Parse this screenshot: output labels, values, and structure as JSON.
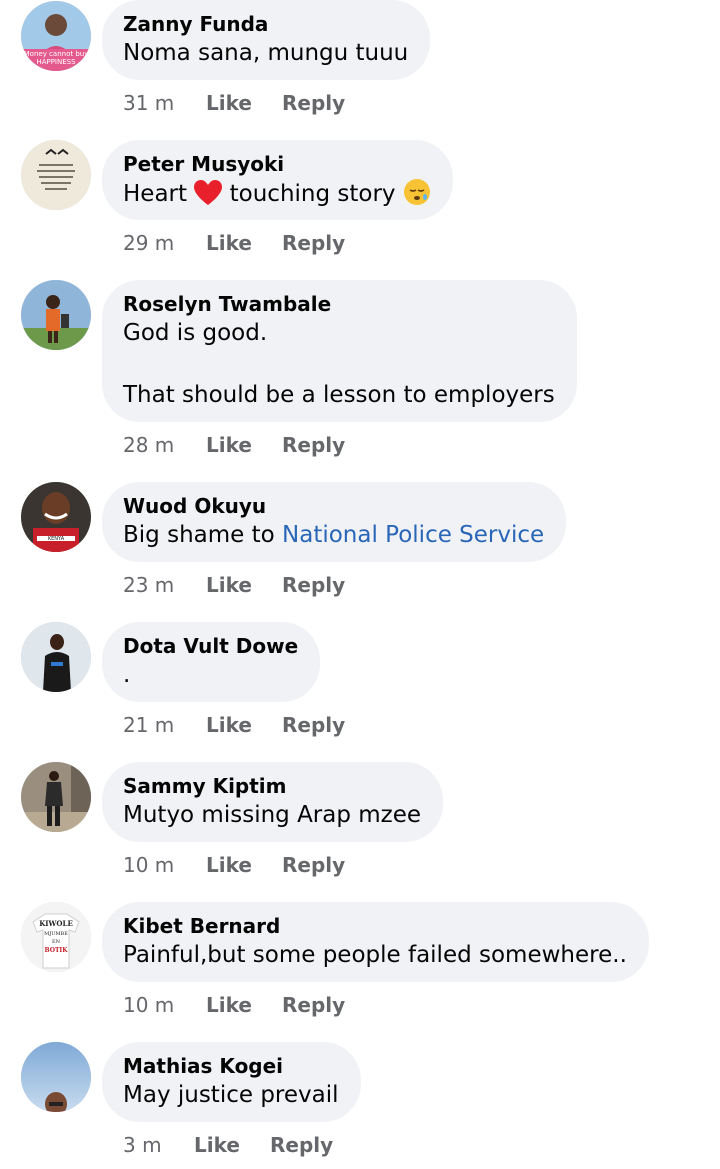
{
  "comments": [
    {
      "name": "Zanny Funda",
      "text": "Noma sana, mungu tuuu",
      "time": "31 m",
      "like": "Like",
      "reply": "Reply",
      "avatar_text": "Money cannot buy HAPPINESS"
    },
    {
      "name": "Peter Musyoki",
      "text_before": "Heart",
      "text_after": "touching story",
      "time": "29 m",
      "like": "Like",
      "reply": "Reply"
    },
    {
      "name": "Roselyn Twambale",
      "line1": "God is good.",
      "line2": "That should be a lesson to employers",
      "time": "28 m",
      "like": "Like",
      "reply": "Reply"
    },
    {
      "name": "Wuod Okuyu",
      "text": "Big shame to ",
      "link": "National Police Service",
      "time": "23 m",
      "like": "Like",
      "reply": "Reply"
    },
    {
      "name": "Dota Vult Dowe",
      "text": ".",
      "time": "21 m",
      "like": "Like",
      "reply": "Reply"
    },
    {
      "name": "Sammy Kiptim",
      "text": "Mutyo missing Arap mzee",
      "time": "10 m",
      "like": "Like",
      "reply": "Reply"
    },
    {
      "name": "Kibet Bernard",
      "text": "Painful,but some people failed somewhere..",
      "time": "10 m",
      "like": "Like",
      "reply": "Reply",
      "avatar_text": "KIWOLE MJUMBE EN BOTIK"
    },
    {
      "name": "Mathias Kogei",
      "text": "May justice prevail",
      "time": "3 m",
      "like": "Like",
      "reply": "Reply"
    }
  ],
  "colors": {
    "bubble": "#f0f2f5",
    "link": "#2a66b7",
    "meta": "#65676b"
  }
}
